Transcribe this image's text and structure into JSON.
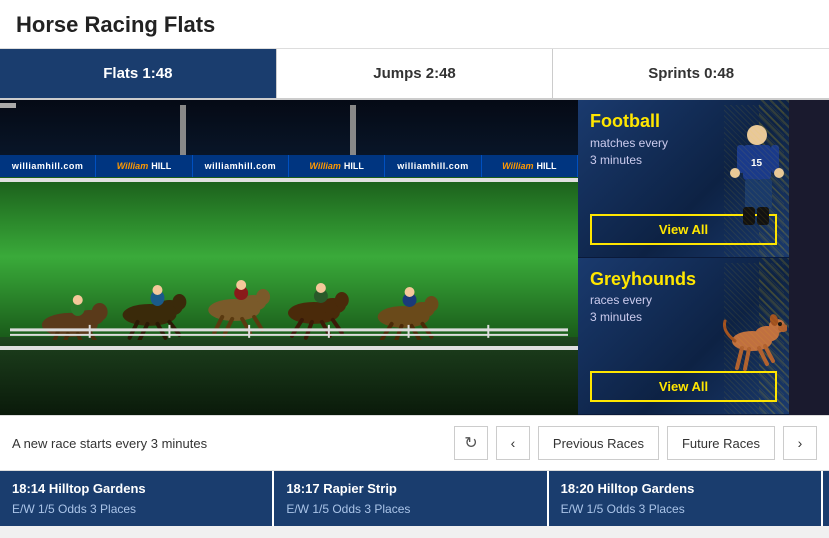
{
  "page": {
    "title": "Horse Racing Flats"
  },
  "tabs": [
    {
      "id": "flats",
      "label": "Flats 1:48",
      "active": true
    },
    {
      "id": "jumps",
      "label": "Jumps 2:48",
      "active": false
    },
    {
      "id": "sprints",
      "label": "Sprints 0:48",
      "active": false
    }
  ],
  "ads": [
    {
      "id": "football",
      "title_highlight": "Football",
      "subtitle": "matches every\n3 minutes",
      "btn_label": "View All",
      "icon": "⚽",
      "image_emoji": "🏈"
    },
    {
      "id": "greyhounds",
      "title_highlight": "Greyhounds",
      "subtitle": "races every\n3 minutes",
      "btn_label": "View All",
      "icon": "🐕",
      "image_emoji": "🐕"
    }
  ],
  "bottom_bar": {
    "info_text": "A new race starts every 3 minutes",
    "prev_label": "Previous Races",
    "future_label": "Future Races",
    "refresh_icon": "↻",
    "prev_icon": "‹",
    "next_icon": "›"
  },
  "race_cards": [
    {
      "title": "18:14 Hilltop Gardens",
      "odds": "E/W 1/5 Odds 3 Places"
    },
    {
      "title": "18:17 Rapier Strip",
      "odds": "E/W 1/5 Odds 3 Places"
    },
    {
      "title": "18:20 Hilltop Gardens",
      "odds": "E/W 1/5 Odds 3 Places"
    }
  ],
  "wh_segments": [
    "williamhill.com",
    "WilliamHILL",
    "williamhill.com",
    "WilliamHILL",
    "williamhill.com",
    "WilliamHILL"
  ]
}
